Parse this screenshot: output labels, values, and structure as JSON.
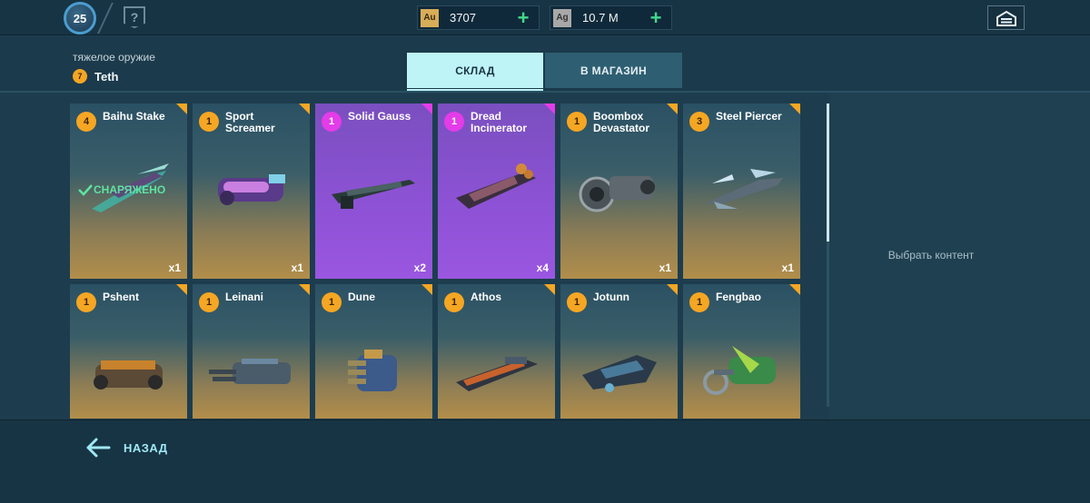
{
  "topbar": {
    "player_level": "25",
    "help_glyph": "?",
    "gold": {
      "symbol": "Au",
      "value": "3707",
      "plus": "+"
    },
    "silver": {
      "symbol": "Ag",
      "value": "10.7 M",
      "plus": "+"
    },
    "garage_icon": "hangar-icon"
  },
  "header": {
    "category": "тяжелое оружие",
    "pilot_level": "7",
    "pilot_name": "Teth"
  },
  "tabs": {
    "storage": "СКЛАД",
    "shop": "В МАГАЗИН"
  },
  "cards": [
    {
      "level": "4",
      "name": "Baihu Stake",
      "qty": "x1",
      "rarity": "common",
      "equipped": true
    },
    {
      "level": "1",
      "name": "Sport Screamer",
      "qty": "x1",
      "rarity": "common"
    },
    {
      "level": "1",
      "name": "Solid Gauss",
      "qty": "x2",
      "rarity": "epic"
    },
    {
      "level": "1",
      "name": "Dread Incinerator",
      "qty": "x4",
      "rarity": "epic"
    },
    {
      "level": "1",
      "name": "Boombox Devastator",
      "qty": "x1",
      "rarity": "common"
    },
    {
      "level": "3",
      "name": "Steel Piercer",
      "qty": "x1",
      "rarity": "common"
    },
    {
      "level": "1",
      "name": "Pshent",
      "rarity": "common"
    },
    {
      "level": "1",
      "name": "Leinani",
      "rarity": "common"
    },
    {
      "level": "1",
      "name": "Dune",
      "rarity": "common"
    },
    {
      "level": "1",
      "name": "Athos",
      "rarity": "common"
    },
    {
      "level": "1",
      "name": "Jotunn",
      "rarity": "common"
    },
    {
      "level": "1",
      "name": "Fengbao",
      "rarity": "common"
    }
  ],
  "equipped_label": "СНАРЯЖЕНО",
  "right_panel": {
    "select_content": "Выбрать контент"
  },
  "footer": {
    "back_label": "НАЗАД"
  },
  "colors": {
    "common_badge": "#f5a623",
    "epic_badge": "#e33ce8",
    "accent_cyan": "#bff4f6",
    "plus_green": "#44d88a"
  }
}
